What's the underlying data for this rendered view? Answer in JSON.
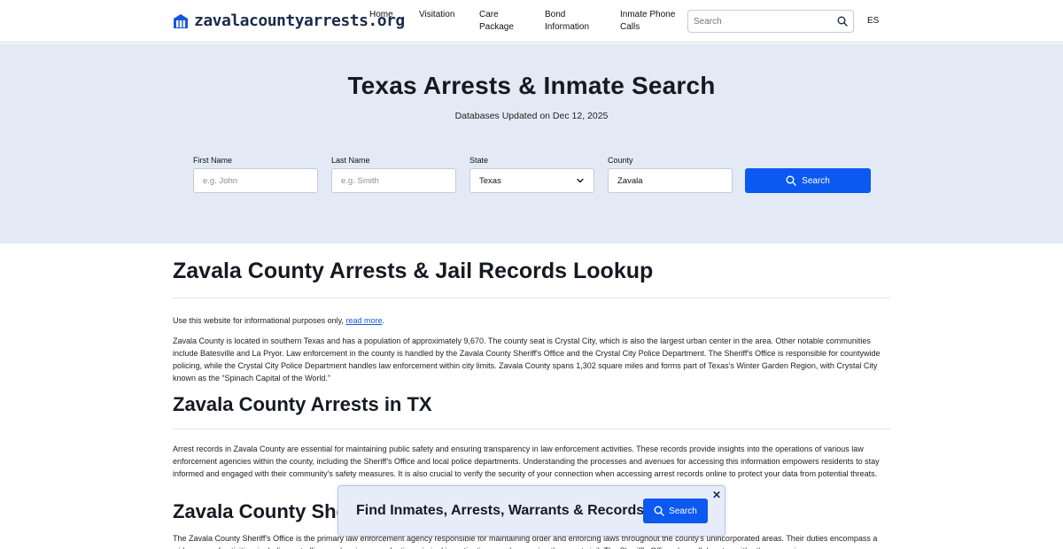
{
  "header": {
    "logo_text": "zavalacountyarrests.org",
    "nav": [
      {
        "label": "Home"
      },
      {
        "label": "Visitation"
      },
      {
        "label": "Care Package"
      },
      {
        "label": "Bond Information"
      },
      {
        "label": "Inmate Phone Calls"
      }
    ],
    "search_placeholder": "Search",
    "lang": "ES",
    "icons": {
      "search": "search-icon",
      "logo": "building-icon"
    }
  },
  "hero": {
    "title": "Texas Arrests & Inmate Search",
    "subtitle": "Databases Updated on Dec 12, 2025",
    "first_name_label": "First Name",
    "first_name_placeholder": "e.g. John",
    "last_name_label": "Last Name",
    "last_name_placeholder": "e.g. Smith",
    "state_label": "State",
    "state_value": "Texas",
    "county_label": "County",
    "county_value": "Zavala",
    "button_label": "Search"
  },
  "content": {
    "heading1": "Zavala County Arrests & Jail Records Lookup",
    "notice_prefix": "Use this website for informational purposes only, ",
    "notice_link": "read more",
    "notice_suffix": ".",
    "para1": "Zavala County is located in southern Texas and has a population of approximately 9,670. The county seat is Crystal City, which is also the largest urban center in the area. Other notable communities include Batesville and La Pryor. Law enforcement in the county is handled by the Zavala County Sheriff's Office and the Crystal City Police Department. The Sheriff's Office is responsible for countywide policing, while the Crystal City Police Department handles law enforcement within city limits. Zavala County spans 1,302 square miles and forms part of Texas's Winter Garden Region, with Crystal City known as the “Spinach Capital of the World.”",
    "heading2": "Zavala County Arrests in TX",
    "para2": "Arrest records in Zavala County are essential for maintaining public safety and ensuring transparency in law enforcement activities. These records provide insights into the operations of various law enforcement agencies within the county, including the Sheriff's Office and local police departments. Understanding the processes and avenues for accessing this information empowers residents to stay informed and engaged with their community's safety measures. It is also crucial to verify the security of your connection when accessing arrest records online to protect your data from potential threats.",
    "heading3": "Zavala County Sheriff's Office",
    "para3": "The Zavala County Sheriff's Office is the primary law enforcement agency responsible for maintaining order and enforcing laws throughout the county's unincorporated areas. Their duties encompass a wide range of activities, including patrolling rural regions, conducting criminal investigations, and managing the county jail. The Sheriff's Office also collaborates with other agencies"
  },
  "sticky": {
    "text": "Find Inmates, Arrests, Warrants & Records",
    "button_label": "Search",
    "close_symbol": "✕"
  },
  "colors": {
    "accent": "#0b59f0",
    "hero_bg": "#e3eaf6",
    "sticky_bg": "#e6edf9",
    "link": "#1a56db"
  }
}
